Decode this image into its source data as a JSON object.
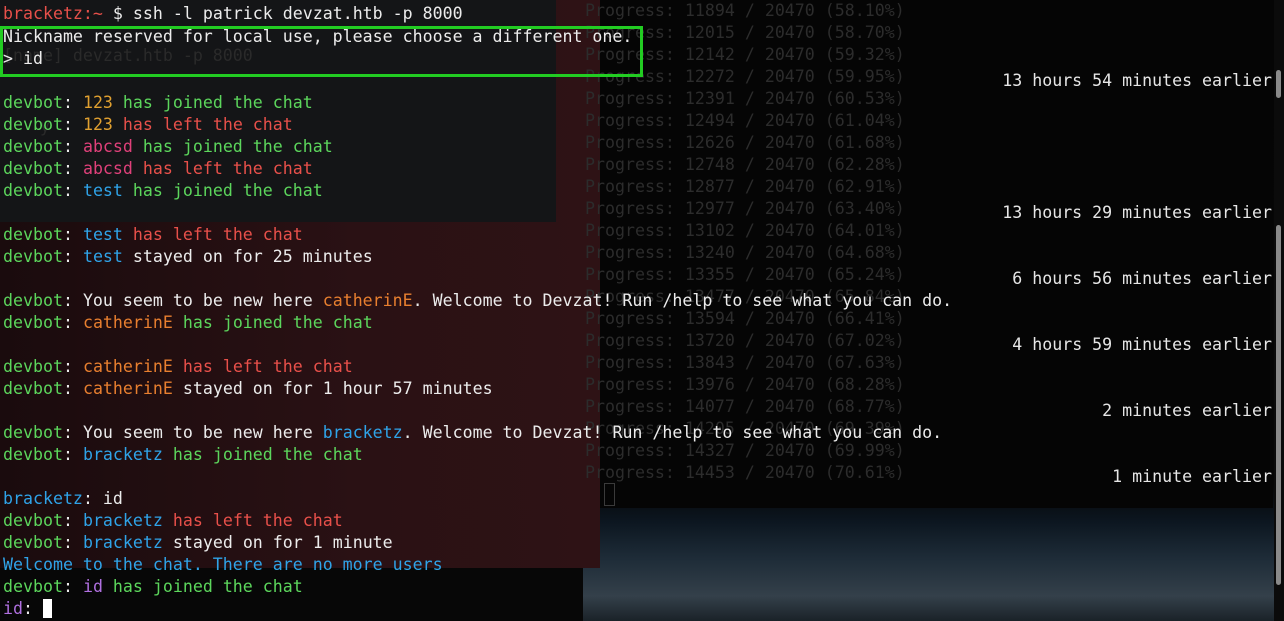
{
  "terminal": {
    "prompt_user": "bracketz:~",
    "prompt_symbol": "$",
    "command": "ssh -l patrick devzat.htb -p 8000",
    "reserved_msg": "Nickname reserved for local use, please choose a different one.",
    "input_prompt": "> id",
    "ghost_line": "[name] devzat.htb -p 8000",
    "ghost_line2": "y"
  },
  "chat": [
    {
      "sender": "devbot",
      "name": "123",
      "name_color": "orange",
      "msg": " has joined the chat",
      "msg_color": "green"
    },
    {
      "sender": "devbot",
      "name": "123",
      "name_color": "orange",
      "msg": " has left the chat",
      "msg_color": "red"
    },
    {
      "sender": "devbot",
      "name": "abcsd",
      "name_color": "magenta",
      "msg": " has joined the chat",
      "msg_color": "green"
    },
    {
      "sender": "devbot",
      "name": "abcsd",
      "name_color": "magenta",
      "msg": " has left the chat",
      "msg_color": "red"
    },
    {
      "sender": "devbot",
      "name": "test",
      "name_color": "blue",
      "msg": " has joined the chat",
      "msg_color": "green"
    },
    {
      "sender": "devbot",
      "name": "test",
      "name_color": "blue",
      "msg": " has left the chat",
      "msg_color": "red"
    },
    {
      "sender": "devbot",
      "name": "test",
      "name_color": "blue",
      "msg": " stayed on for 25 minutes",
      "msg_color": "white"
    },
    {
      "sender": "devbot",
      "pre": "You seem to be new here ",
      "name": "catherinE",
      "name_color": "orange2",
      "msg": ". Welcome to Devzat! Run /help to see what you can do.",
      "msg_color": "white"
    },
    {
      "sender": "devbot",
      "name": "catherinE",
      "name_color": "orange2",
      "msg": " has joined the chat",
      "msg_color": "green"
    },
    {
      "sender": "devbot",
      "name": "catherinE",
      "name_color": "orange2",
      "msg": " has left the chat",
      "msg_color": "red"
    },
    {
      "sender": "devbot",
      "name": "catherinE",
      "name_color": "orange2",
      "msg": " stayed on for 1 hour 57 minutes",
      "msg_color": "white"
    },
    {
      "sender": "devbot",
      "pre": "You seem to be new here ",
      "name": "bracketz",
      "name_color": "blue",
      "msg": ". Welcome to Devzat! Run /help to see what you can do.",
      "msg_color": "white"
    },
    {
      "sender": "devbot",
      "name": "bracketz",
      "name_color": "blue",
      "msg": " has joined the chat",
      "msg_color": "green"
    },
    {
      "sender": "bracketz",
      "msg": " id",
      "msg_color": "white"
    },
    {
      "sender": "devbot",
      "name": "bracketz",
      "name_color": "blue",
      "msg": " has left the chat",
      "msg_color": "red"
    },
    {
      "sender": "devbot",
      "name": "bracketz",
      "name_color": "blue",
      "msg": " stayed on for 1 minute",
      "msg_color": "white"
    },
    {
      "welcome": "Welcome to the chat. There are no more users"
    },
    {
      "sender": "devbot",
      "name": "id",
      "name_color": "purple",
      "msg": " has joined the chat",
      "msg_color": "green"
    }
  ],
  "input_line": {
    "user": "id",
    "separator": ":"
  },
  "progress": [
    "Progress: 11894 / 20470 (58.10%)",
    "Progress: 12015 / 20470 (58.70%)",
    "Progress: 12142 / 20470 (59.32%)",
    "Progress: 12272 / 20470 (59.95%)",
    "Progress: 12391 / 20470 (60.53%)",
    "Progress: 12494 / 20470 (61.04%)",
    "Progress: 12626 / 20470 (61.68%)",
    "Progress: 12748 / 20470 (62.28%)",
    "Progress: 12877 / 20470 (62.91%)",
    "Progress: 12977 / 20470 (63.40%)",
    "Progress: 13102 / 20470 (64.01%)",
    "Progress: 13240 / 20470 (64.68%)",
    "Progress: 13355 / 20470 (65.24%)",
    "Progress: 13477 / 20470 (65.84%)",
    "Progress: 13594 / 20470 (66.41%)",
    "Progress: 13720 / 20470 (67.02%)",
    "Progress: 13843 / 20470 (67.63%)",
    "Progress: 13976 / 20470 (68.28%)",
    "Progress: 14077 / 20470 (68.77%)",
    "Progress: 14205 / 20470 (69.39%)",
    "Progress: 14327 / 20470 (69.99%)",
    "Progress: 14453 / 20470 (70.61%)"
  ],
  "timestamps": [
    "13 hours 54 minutes earlier",
    "13 hours 29 minutes earlier",
    "6 hours 56 minutes earlier",
    "4 hours 59 minutes earlier",
    "2 minutes earlier",
    "1 minute earlier"
  ]
}
